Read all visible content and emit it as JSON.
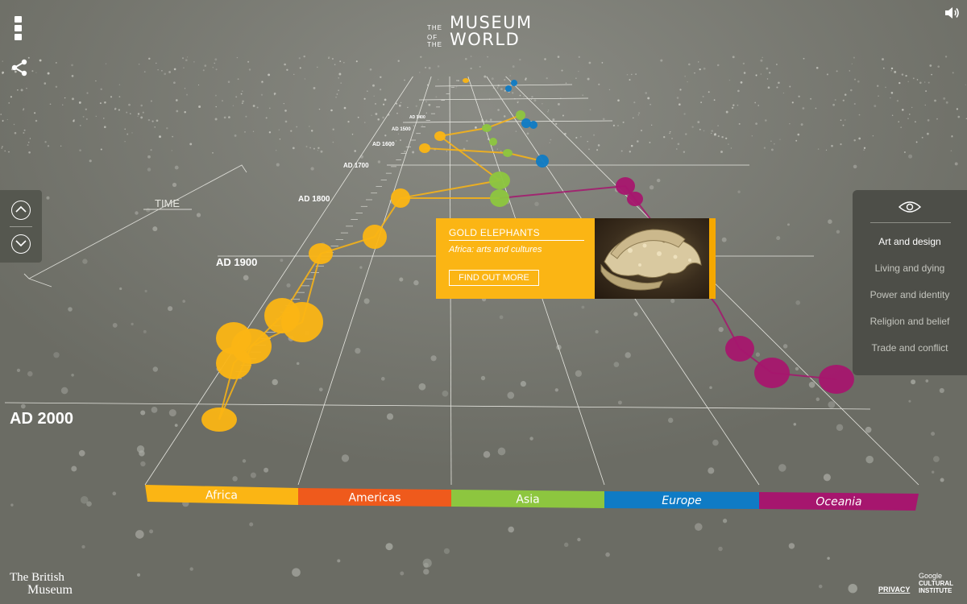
{
  "logo": {
    "the": "THE",
    "museum": "MUSEUM",
    "ofthe": "OF THE",
    "world": "WORLD"
  },
  "timeline": {
    "axis_label": "TIME",
    "year_labels": [
      "AD 2000",
      "AD 1900",
      "AD 1800",
      "AD 1700",
      "AD 1600",
      "AD 1500",
      "AD 1400"
    ]
  },
  "regions": [
    {
      "name": "Africa",
      "color": "#fbb514"
    },
    {
      "name": "Americas",
      "color": "#ef5a1c"
    },
    {
      "name": "Asia",
      "color": "#8dc63f"
    },
    {
      "name": "Europe",
      "color": "#0f7bc5"
    },
    {
      "name": "Oceania",
      "color": "#a6166e"
    }
  ],
  "card": {
    "title": "GOLD ELEPHANTS",
    "subtitle": "Africa: arts and cultures",
    "button": "FIND OUT MORE",
    "accent": "#fbb514"
  },
  "filters": {
    "icon": "eye-icon",
    "items": [
      "Art and design",
      "Living and dying",
      "Power and identity",
      "Religion and belief",
      "Trade and conflict"
    ],
    "active_index": 0
  },
  "icons": {
    "menu": "menu-icon",
    "share": "share-icon",
    "sound": "sound-icon",
    "up": "chevron-up-icon",
    "down": "chevron-down-icon"
  },
  "footer": {
    "museum_line1": "The British",
    "museum_line2": "Museum",
    "privacy": "PRIVACY",
    "partner_line1": "Google",
    "partner_line2": "CULTURAL",
    "partner_line3": "INSTITUTE"
  }
}
